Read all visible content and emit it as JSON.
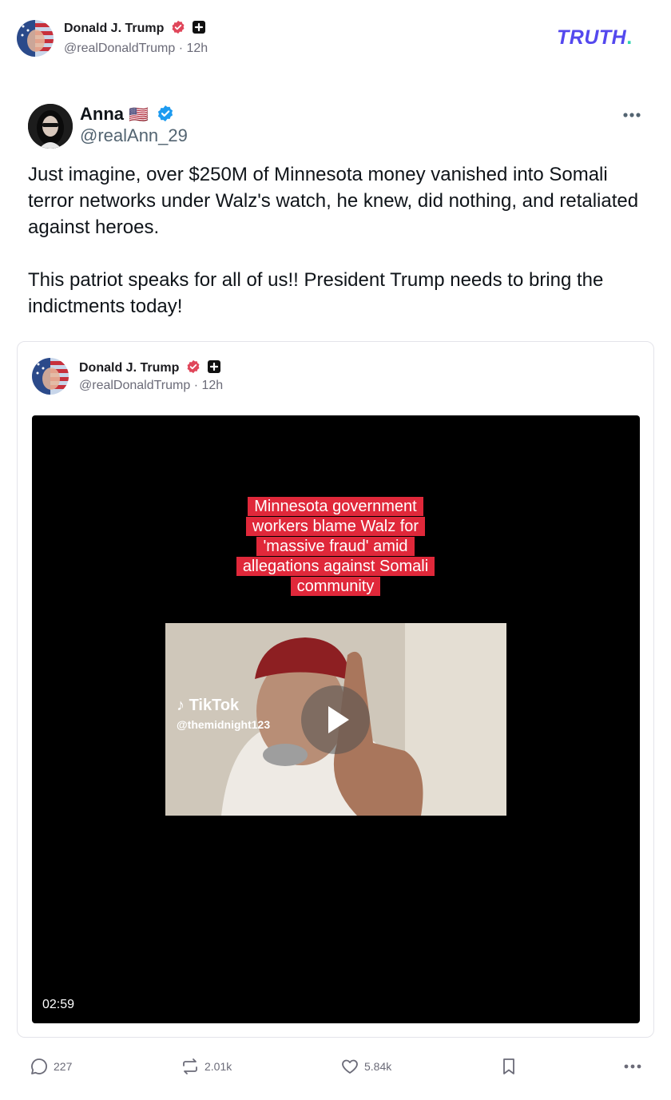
{
  "header": {
    "author_name": "Donald J. Trump",
    "author_handle": "@realDonaldTrump",
    "time": "12h",
    "logo_text": "TRUTH",
    "logo_dot": "."
  },
  "quoted_post": {
    "author_name": "Anna",
    "flag": "🇺🇸",
    "author_handle": "@realAnn_29",
    "paragraphs": [
      "Just imagine, over $250M of Minnesota money vanished into Somali terror networks under Walz's watch, he knew, did nothing, and retaliated against heroes.",
      "This patriot speaks for all of us!! President Trump needs to bring the indictments today!"
    ]
  },
  "embedded_post": {
    "author_name": "Donald J. Trump",
    "author_handle": "@realDonaldTrump",
    "time": "12h",
    "video": {
      "caption": "Minnesota government workers blame Walz for 'massive fraud' amid allegations against Somali community",
      "watermark_brand": "TikTok",
      "watermark_user": "@themidnight123",
      "duration": "02:59"
    }
  },
  "actions": {
    "replies": "227",
    "retruths": "2.01k",
    "likes": "5.84k"
  },
  "colors": {
    "brand": "#5448ee",
    "verified_pink": "#e0465a",
    "verified_blue": "#1d9bf0",
    "caption_red": "#e0283a"
  }
}
